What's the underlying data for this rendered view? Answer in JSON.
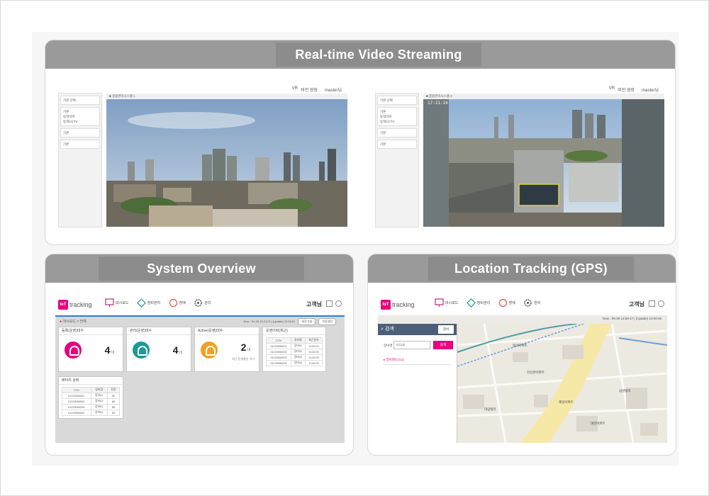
{
  "streaming": {
    "title": "Real-time Video Streaming",
    "cams": [
      {
        "top_links": [
          "VR",
          "비전 광장",
          "master님"
        ],
        "view_title": "■ 종합관리시스템 1",
        "osd": "",
        "side": [
          "기본 선택",
          "기본",
          "동적마커",
          "동적CCTV",
          "기본",
          "기본"
        ]
      },
      {
        "top_links": [
          "VR",
          "비전 광장",
          "master님"
        ],
        "view_title": "■ 종합관리시스템 2",
        "osd": "17:21:16",
        "side": [
          "기본 선택",
          "기본",
          "동적마커",
          "동적CCTV",
          "기본",
          "기본"
        ]
      }
    ]
  },
  "overview": {
    "title": "System Overview",
    "logo_badge": "IoT",
    "logo_text": "tracking",
    "menu": [
      "대시보드",
      "장비관리",
      "장애",
      "관리"
    ],
    "user": "고객님",
    "breadcrumb": "대시보드 > 전체",
    "status": "Now : 01-28 13:21:21 | (update) 11:28:51",
    "btn_refresh": "새로고침",
    "btn_settings": "자동설정",
    "cards": [
      {
        "title": "등록(운영)대수",
        "value": "4",
        "unit": "대",
        "color": "#e6007e"
      },
      {
        "title": "관리(운영)대수",
        "value": "4",
        "unit": "대",
        "color": "#1a9a98"
      },
      {
        "title": "Active(운영)대수",
        "value": "2",
        "unit": "대",
        "color": "#f2a024",
        "note": "최근 운영중인 기기"
      }
    ],
    "table_right": {
      "title": "운영이력(최근)",
      "headers": [
        "CTN",
        "장비명",
        "최근일자"
      ],
      "rows": [
        [
          "01229050001",
          "장비01",
          "11:00:00"
        ],
        [
          "01229050002",
          "장비02",
          "11:00:00"
        ],
        [
          "01229050003",
          "장비03",
          "11:00:00"
        ],
        [
          "01229050004",
          "장비04",
          "11:00:00"
        ]
      ]
    },
    "table_left": {
      "title": "배터리 상태",
      "headers": [
        "CTN",
        "장비명",
        "잔량"
      ],
      "rows": [
        [
          "01229050001",
          "장비01",
          "90"
        ],
        [
          "01229050002",
          "장비02",
          "88"
        ],
        [
          "01229050003",
          "장비03",
          "85"
        ],
        [
          "01229050004",
          "장비04",
          "80"
        ]
      ]
    }
  },
  "gps": {
    "title": "Location Tracking (GPS)",
    "logo_badge": "IoT",
    "logo_text": "tracking",
    "menu": [
      "대시보드",
      "장비관리",
      "장애",
      "관리"
    ],
    "user": "고객님",
    "status": "Now : 05-30 13:59:47 | (Update) 13:00:45",
    "search_title": "검색",
    "search_tab": "장비",
    "search_label": "장비명",
    "search_value": "CCU1",
    "search_button": "검색",
    "result": "장비명(CCU)",
    "map_labels": [
      "동아아파트",
      "한신한아파트",
      "대림빌라",
      "제일아파트",
      "삼성빌라",
      "대한아파트"
    ]
  }
}
